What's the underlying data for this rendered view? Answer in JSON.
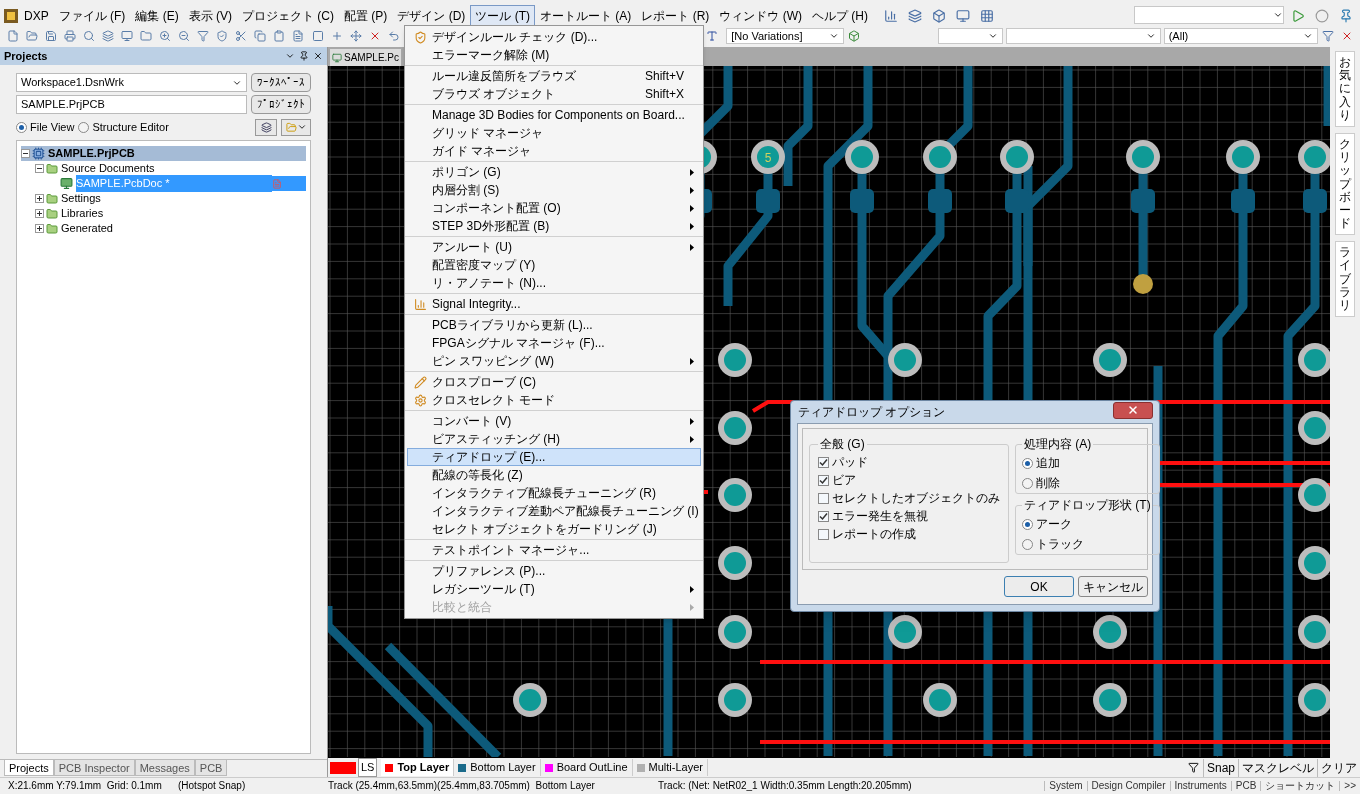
{
  "menu_bar": {
    "items": [
      {
        "label": "DXP",
        "selected": false
      },
      {
        "label": "ファイル (F)",
        "selected": false
      },
      {
        "label": "編集 (E)",
        "selected": false
      },
      {
        "label": "表示 (V)",
        "selected": false
      },
      {
        "label": "プロジェクト (C)",
        "selected": false
      },
      {
        "label": "配置 (P)",
        "selected": false
      },
      {
        "label": "デザイン (D)",
        "selected": false
      },
      {
        "label": "ツール (T)",
        "selected": true
      },
      {
        "label": "オートルート (A)",
        "selected": false
      },
      {
        "label": "レポート (R)",
        "selected": false
      },
      {
        "label": "ウィンドウ (W)",
        "selected": false
      },
      {
        "label": "ヘルプ (H)",
        "selected": false
      }
    ]
  },
  "toolbar": {
    "variation_select": "[No Variations]",
    "filter_select": "(All)"
  },
  "projects_panel": {
    "title": "Projects",
    "workspace": "Workspace1.DsnWrk",
    "workspace_button": "ﾜｰｸｽﾍﾟｰｽ",
    "project": "SAMPLE.PrjPCB",
    "project_button": "ﾌﾟﾛｼﾞｪｸﾄ",
    "views": [
      {
        "label": "File View",
        "selected": true
      },
      {
        "label": "Structure Editor",
        "selected": false
      }
    ],
    "tree": [
      {
        "label": "SAMPLE.PrjPCB",
        "kind": "project",
        "selected": false,
        "expanded": true,
        "children": [
          {
            "label": "Source Documents",
            "kind": "folder",
            "selected": false,
            "expanded": true,
            "children": [
              {
                "label": "SAMPLE.PcbDoc *",
                "kind": "document",
                "selected": true
              }
            ]
          },
          {
            "label": "Settings",
            "kind": "folder",
            "selected": false,
            "expanded": false
          },
          {
            "label": "Libraries",
            "kind": "folder",
            "selected": false,
            "expanded": false
          },
          {
            "label": "Generated",
            "kind": "folder",
            "selected": false,
            "expanded": false
          }
        ]
      }
    ],
    "tabs": [
      {
        "label": "Projects",
        "selected": true
      },
      {
        "label": "PCB Inspector",
        "selected": false
      },
      {
        "label": "Messages",
        "selected": false
      },
      {
        "label": "PCB",
        "selected": false
      }
    ]
  },
  "document_tab": "SAMPLE.Pc",
  "tools_menu": {
    "groups": [
      [
        {
          "label": "デザインルール チェック (D)...",
          "icon": true,
          "submenu": false,
          "selected": false,
          "disabled": false
        },
        {
          "label": "エラーマーク解除 (M)",
          "icon": false,
          "submenu": false,
          "selected": false,
          "disabled": false
        }
      ],
      [
        {
          "label": "ルール違反箇所をブラウズ",
          "shortcut": "Shift+V",
          "icon": false,
          "submenu": false,
          "selected": false,
          "disabled": false
        },
        {
          "label": "ブラウズ オブジェクト",
          "shortcut": "Shift+X",
          "icon": false,
          "submenu": false,
          "selected": false,
          "disabled": false
        }
      ],
      [
        {
          "label": "Manage 3D Bodies for Components on Board...",
          "icon": false,
          "submenu": false,
          "selected": false,
          "disabled": false
        },
        {
          "label": "グリッド マネージャ",
          "icon": false,
          "submenu": false,
          "selected": false,
          "disabled": false
        },
        {
          "label": "ガイド マネージャ",
          "icon": false,
          "submenu": false,
          "selected": false,
          "disabled": false
        }
      ],
      [
        {
          "label": "ポリゴン (G)",
          "icon": false,
          "submenu": true,
          "selected": false,
          "disabled": false
        },
        {
          "label": "内層分割 (S)",
          "icon": false,
          "submenu": true,
          "selected": false,
          "disabled": false
        },
        {
          "label": "コンポーネント配置 (O)",
          "icon": false,
          "submenu": true,
          "selected": false,
          "disabled": false
        },
        {
          "label": "STEP 3D外形配置 (B)",
          "icon": false,
          "submenu": true,
          "selected": false,
          "disabled": false
        }
      ],
      [
        {
          "label": "アンルート (U)",
          "icon": false,
          "submenu": true,
          "selected": false,
          "disabled": false
        },
        {
          "label": "配置密度マップ (Y)",
          "icon": false,
          "submenu": false,
          "selected": false,
          "disabled": false
        },
        {
          "label": "リ・アノテート (N)...",
          "icon": false,
          "submenu": false,
          "selected": false,
          "disabled": false
        }
      ],
      [
        {
          "label": "Signal Integrity...",
          "icon": true,
          "submenu": false,
          "selected": false,
          "disabled": false
        }
      ],
      [
        {
          "label": "PCBライブラリから更新 (L)...",
          "icon": false,
          "submenu": false,
          "selected": false,
          "disabled": false
        },
        {
          "label": "FPGAシグナル マネージャ (F)...",
          "icon": false,
          "submenu": false,
          "selected": false,
          "disabled": false
        },
        {
          "label": "ピン スワッピング (W)",
          "icon": false,
          "submenu": true,
          "selected": false,
          "disabled": false
        }
      ],
      [
        {
          "label": "クロスプローブ (C)",
          "icon": true,
          "submenu": false,
          "selected": false,
          "disabled": false
        },
        {
          "label": "クロスセレクト モード",
          "icon": true,
          "submenu": false,
          "selected": false,
          "disabled": false
        }
      ],
      [
        {
          "label": "コンバート (V)",
          "icon": false,
          "submenu": true,
          "selected": false,
          "disabled": false
        },
        {
          "label": "ビアスティッチング (H)",
          "icon": false,
          "submenu": true,
          "selected": false,
          "disabled": false
        },
        {
          "label": "ティアドロップ (E)...",
          "icon": false,
          "submenu": false,
          "selected": true,
          "disabled": false
        },
        {
          "label": "配線の等長化 (Z)",
          "icon": false,
          "submenu": false,
          "selected": false,
          "disabled": false
        },
        {
          "label": "インタラクティブ配線長チューニング (R)",
          "icon": false,
          "submenu": false,
          "selected": false,
          "disabled": false
        },
        {
          "label": "インタラクティブ差動ペア配線長チューニング (I)",
          "icon": false,
          "submenu": false,
          "selected": false,
          "disabled": false
        },
        {
          "label": "セレクト オブジェクトをガードリング (J)",
          "icon": false,
          "submenu": false,
          "selected": false,
          "disabled": false
        }
      ],
      [
        {
          "label": "テストポイント マネージャ...",
          "icon": false,
          "submenu": false,
          "selected": false,
          "disabled": false
        }
      ],
      [
        {
          "label": "プリファレンス (P)...",
          "icon": false,
          "submenu": false,
          "selected": false,
          "disabled": false
        },
        {
          "label": "レガシーツール (T)",
          "icon": false,
          "submenu": true,
          "selected": false,
          "disabled": false
        },
        {
          "label": "比較と統合",
          "icon": false,
          "submenu": true,
          "selected": false,
          "disabled": true
        }
      ]
    ]
  },
  "side_tabs": [
    "お気に入り",
    "クリップボード",
    "ライブラリ"
  ],
  "pcb": {
    "pad_label": "5"
  },
  "dialog": {
    "title": "ティアドロップ オプション",
    "general": {
      "title": "全般 (G)",
      "options": [
        {
          "label": "パッド",
          "checked": true
        },
        {
          "label": "ビア",
          "checked": true
        },
        {
          "label": "セレクトしたオブジェクトのみ",
          "checked": false
        },
        {
          "label": "エラー発生を無視",
          "checked": true
        },
        {
          "label": "レポートの作成",
          "checked": false
        }
      ]
    },
    "action": {
      "title": "処理内容 (A)",
      "options": [
        {
          "label": "追加",
          "selected": true
        },
        {
          "label": "削除",
          "selected": false
        }
      ]
    },
    "shape": {
      "title": "ティアドロップ形状 (T)",
      "options": [
        {
          "label": "アーク",
          "selected": true
        },
        {
          "label": "トラック",
          "selected": false
        }
      ]
    },
    "buttons": [
      "OK",
      "キャンセル"
    ]
  },
  "layer_bar": {
    "current": {
      "label": "LS",
      "color": "#ff0000"
    },
    "layers": [
      {
        "label": "Top Layer",
        "color": "#ff0000",
        "selected": true
      },
      {
        "label": "Bottom Layer",
        "color": "#1a6a8a",
        "selected": false
      },
      {
        "label": "Board OutLine",
        "color": "#ff00ff",
        "selected": false
      },
      {
        "label": "Multi-Layer",
        "color": "#b0b0b0",
        "selected": false
      }
    ],
    "tools": [
      "Snap",
      "マスクレベル",
      "クリア"
    ]
  },
  "status_bar": {
    "items": [
      "X:21.6mm Y:79.1mm  Grid: 0.1mm",
      "(Hotspot Snap)",
      "Track (25.4mm,63.5mm)(25.4mm,83.705mm)  Bottom Layer",
      "Track: (Net: NetR02_1 Width:0.35mm Length:20.205mm)"
    ],
    "panels": [
      "System",
      "Design Compiler",
      "Instruments",
      "PCB",
      "ショートカット",
      ">>"
    ]
  }
}
